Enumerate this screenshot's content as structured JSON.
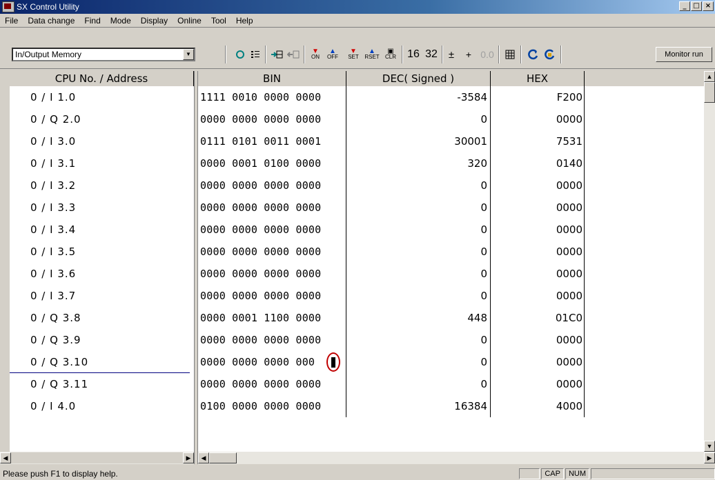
{
  "window": {
    "title": "SX Control Utility"
  },
  "menu": [
    {
      "label": "File"
    },
    {
      "label": "Data change"
    },
    {
      "label": "Find"
    },
    {
      "label": "Mode"
    },
    {
      "label": "Display"
    },
    {
      "label": "Online"
    },
    {
      "label": "Tool"
    },
    {
      "label": "Help"
    }
  ],
  "toolbar": {
    "memory_select": "In/Output Memory",
    "on_label": "ON",
    "off_label": "OFF",
    "set_label": "SET",
    "rset_label": "RSET",
    "clr_label": "CLR",
    "bits16": "16",
    "bits32": "32",
    "plusminus": "±",
    "plus": "+",
    "float": "0.0",
    "monitor_run": "Monitor run"
  },
  "columns": {
    "address": "CPU No. / Address",
    "bin": "BIN",
    "dec": "DEC( Signed )",
    "hex": "HEX"
  },
  "rows": [
    {
      "address": "0 / I 1.0",
      "bin": "1111 0010 0000 0000",
      "dec": "-3584",
      "hex": "F200"
    },
    {
      "address": "0 / Q 2.0",
      "bin": "0000 0000 0000 0000",
      "dec": "0",
      "hex": "0000"
    },
    {
      "address": "0 / I 3.0",
      "bin": "0111 0101 0011 0001",
      "dec": "30001",
      "hex": "7531"
    },
    {
      "address": "0 / I 3.1",
      "bin": "0000 0001 0100 0000",
      "dec": "320",
      "hex": "0140"
    },
    {
      "address": "0 / I 3.2",
      "bin": "0000 0000 0000 0000",
      "dec": "0",
      "hex": "0000"
    },
    {
      "address": "0 / I 3.3",
      "bin": "0000 0000 0000 0000",
      "dec": "0",
      "hex": "0000"
    },
    {
      "address": "0 / I 3.4",
      "bin": "0000 0000 0000 0000",
      "dec": "0",
      "hex": "0000"
    },
    {
      "address": "0 / I 3.5",
      "bin": "0000 0000 0000 0000",
      "dec": "0",
      "hex": "0000"
    },
    {
      "address": "0 / I 3.6",
      "bin": "0000 0000 0000 0000",
      "dec": "0",
      "hex": "0000"
    },
    {
      "address": "0 / I 3.7",
      "bin": "0000 0000 0000 0000",
      "dec": "0",
      "hex": "0000"
    },
    {
      "address": "0 / Q 3.8",
      "bin": "0000 0001 1100 0000",
      "dec": "448",
      "hex": "01C0"
    },
    {
      "address": "0 / Q 3.9",
      "bin": "0000 0000 0000 0000",
      "dec": "0",
      "hex": "0000"
    },
    {
      "address": "0 / Q 3.10",
      "bin": "0000 0000 0000 000",
      "dec": "0",
      "hex": "0000"
    },
    {
      "address": "0 / Q 3.11",
      "bin": "0000 0000 0000 0000",
      "dec": "0",
      "hex": "0000"
    },
    {
      "address": "0 / I 4.0",
      "bin": "0100 0000 0000 0000",
      "dec": "16384",
      "hex": "4000"
    }
  ],
  "status": {
    "message": "Please push F1 to display help.",
    "cap": "CAP",
    "num": "NUM"
  }
}
